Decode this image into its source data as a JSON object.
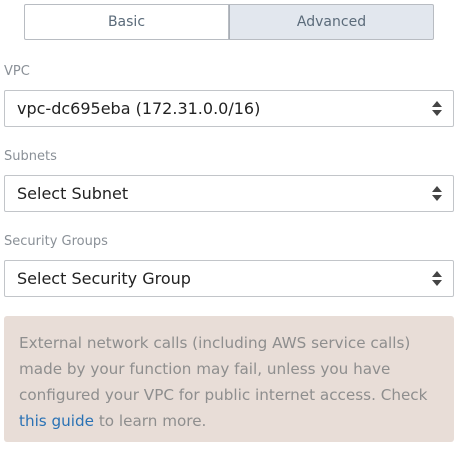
{
  "tabs": {
    "basic": "Basic",
    "advanced": "Advanced"
  },
  "vpc": {
    "label": "VPC",
    "value": "vpc-dc695eba (172.31.0.0/16)"
  },
  "subnets": {
    "label": "Subnets",
    "value": "Select Subnet"
  },
  "security_groups": {
    "label": "Security Groups",
    "value": "Select Security Group"
  },
  "notice": {
    "text_before": "External network calls (including AWS service calls) made by your function may fail, unless you have configured your VPC for public internet access. Check ",
    "link": "this guide",
    "text_after": " to learn more."
  },
  "colors": {
    "active_tab_bg": "#e2e7ee",
    "notice_bg": "#e8ddd7",
    "link": "#2a72b5"
  }
}
